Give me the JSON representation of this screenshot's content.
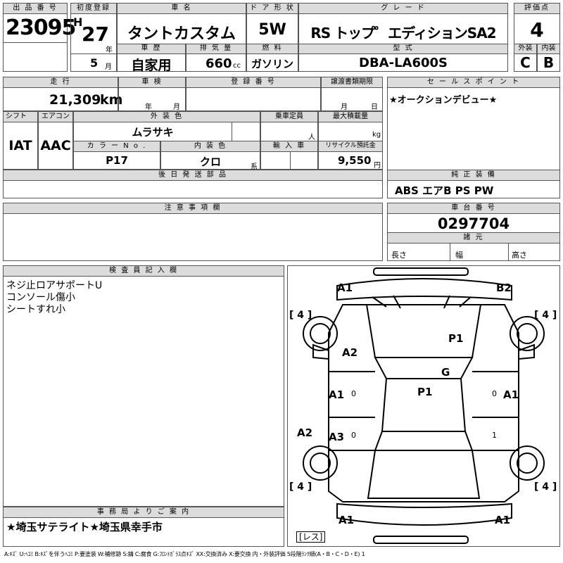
{
  "headers": {
    "lot_no": "出 品 番 号",
    "first_reg": "初度登録",
    "car_name": "車 名",
    "door": "ド ア 形 状",
    "grade": "グ レ ー ド",
    "score": "評価点",
    "history": "車 歴",
    "displacement": "排 気 量",
    "fuel": "燃 料",
    "model": "型 式",
    "exterior": "外装",
    "interior": "内装",
    "mileage": "走 行",
    "inspection": "車 検",
    "reg_no": "登 録 番 号",
    "transfer": "譲渡書類期限",
    "sales_point": "セ ー ル ス ポ イ ン ト",
    "shift": "シフト",
    "aircon": "エアコン",
    "ext_color": "外 装 色",
    "capacity": "乗車定員",
    "max_load": "最大積載量",
    "color_no": "カ ラ ー N o .",
    "int_color": "内 装 色",
    "import": "輸 入 車",
    "recycle": "リサイクル預託金",
    "later_parts": "後 日 発 送 部 品",
    "genuine": "純 正 装 備",
    "notes": "注 意 事 項 欄",
    "chassis": "車 台 番 号",
    "specs": "諸 元",
    "inspector": "検 査 員 記 入 欄",
    "office": "事 務 局 よ り ご 案 内"
  },
  "vehicle": {
    "lot_no": "23095",
    "era": "H",
    "year": "27",
    "year_unit": "年",
    "month": "5",
    "month_unit": "月",
    "car_name": "タントカスタム",
    "door": "5W",
    "grade": "RS トップ゜エディションSA2",
    "score": "4",
    "history": "自家用",
    "displacement": "660",
    "displacement_unit": "cc",
    "fuel": "ガソリン",
    "model": "DBA-LA600S",
    "exterior_grade": "C",
    "interior_grade": "B",
    "mileage": "21,309",
    "mileage_unit": "km",
    "insp_year_unit": "年",
    "insp_month_unit": "月",
    "transfer_month_unit": "月",
    "transfer_day_unit": "日",
    "shift": "IAT",
    "aircon": "AAC",
    "ext_color": "ムラサキ",
    "capacity_unit": "人",
    "max_load_unit": "kg",
    "color_no": "P17",
    "int_color": "クロ",
    "int_color_unit": "系",
    "recycle": "9,550",
    "recycle_unit": "円",
    "sales_point": "★オークションデビュー★",
    "genuine": "ABS エアB PS PW",
    "chassis": "0297704",
    "length_label": "長さ",
    "width_label": "幅",
    "height_label": "高さ"
  },
  "inspector_notes": [
    "ネジ止ロアサポートU",
    "コンソール傷小",
    "シートすれ小"
  ],
  "office_note": "★埼玉サテライト★埼玉県幸手市",
  "diagram": {
    "marks": {
      "front_left": "A1",
      "front_right": "B2",
      "hood": "P1",
      "windshield": "G",
      "roof": "P1",
      "left_front_fender": "A2",
      "left_front_door": "A1",
      "left_rear_door": "A3",
      "left_rear_fender": "A2",
      "right_front_door": "A1",
      "rear_left": "A1",
      "rear_right": "A1",
      "door_ind_1": "0",
      "door_ind_2": "0",
      "door_ind_3": "0",
      "door_ind_4": "1"
    },
    "tires": {
      "fl": "4",
      "fr": "4",
      "rl": "4",
      "rr": "4"
    },
    "less_label": "レス"
  },
  "legend": "A:ｷｽﾞ U:ﾍｺﾐ B:ｷｽﾞを伴うﾍｺﾐ P:要塗装 W:補修跡 S:錆 C:腐食 G:ﾌﾛﾝﾄｶﾞﾗｽ点ｷｽﾞ XX:交換済み X:要交換 内・外装評価 5段階ﾗﾝｸ順(A・B・C・D・E) 1"
}
